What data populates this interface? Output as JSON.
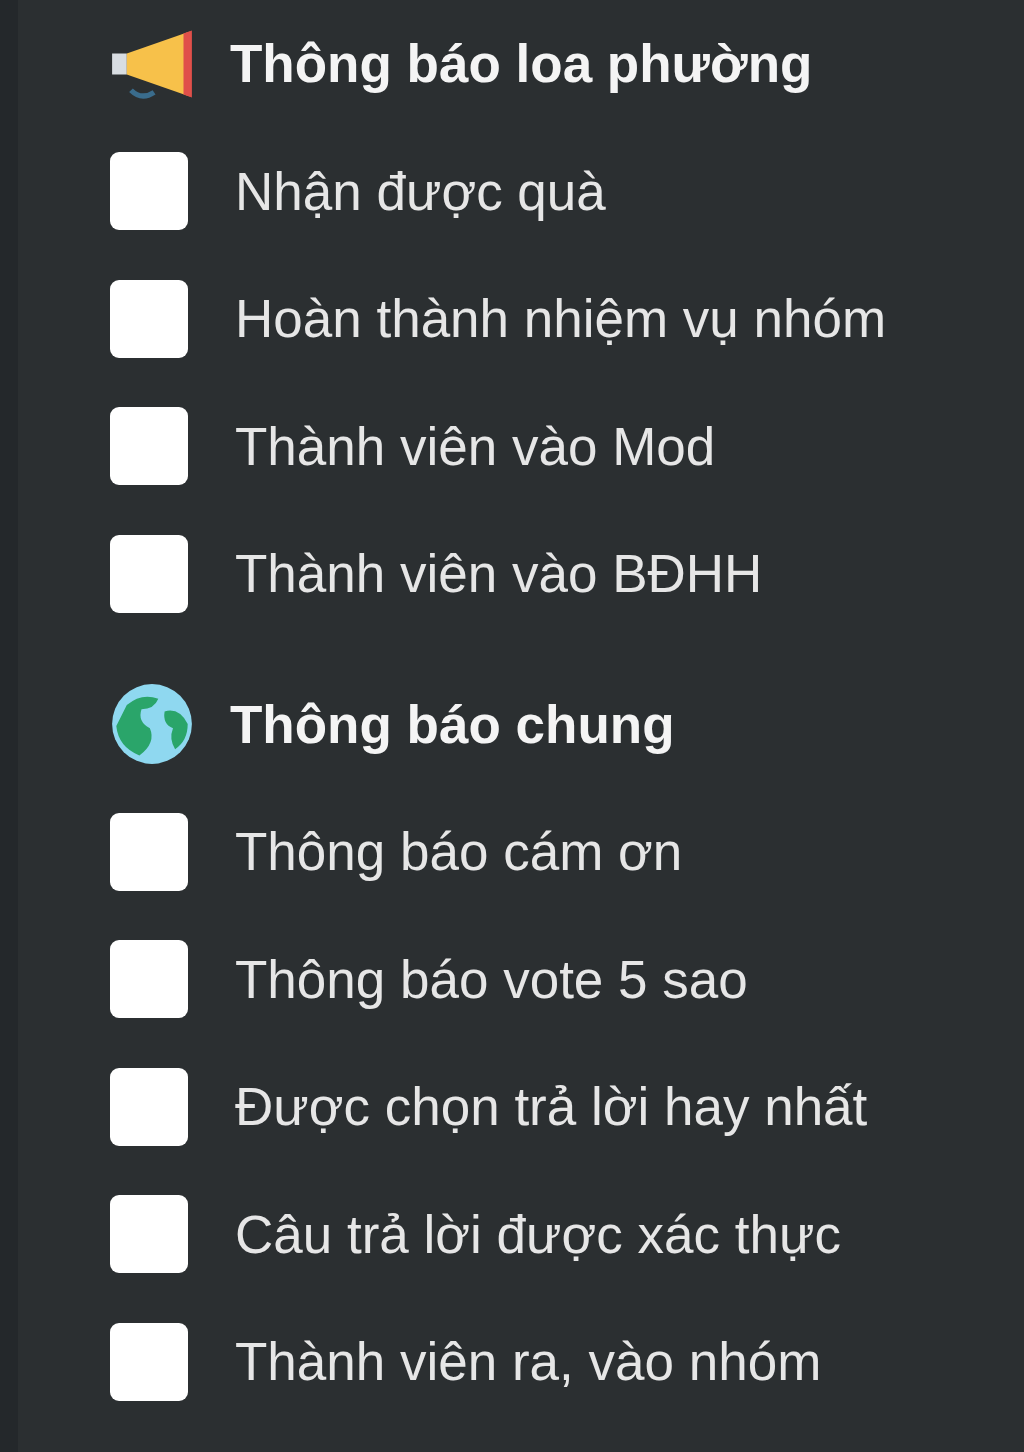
{
  "sections": [
    {
      "title": "Thông báo loa phường",
      "options": [
        {
          "label": "Nhận được quà",
          "checked": false
        },
        {
          "label": "Hoàn thành nhiệm vụ nhóm",
          "checked": false
        },
        {
          "label": "Thành viên vào Mod",
          "checked": false
        },
        {
          "label": "Thành viên vào BĐHH",
          "checked": false
        }
      ]
    },
    {
      "title": "Thông báo chung",
      "options": [
        {
          "label": "Thông báo cám ơn",
          "checked": false
        },
        {
          "label": "Thông báo vote 5 sao",
          "checked": false
        },
        {
          "label": "Được chọn trả lời hay nhất",
          "checked": false
        },
        {
          "label": "Câu trả lời được xác thực",
          "checked": false
        },
        {
          "label": "Thành viên ra, vào nhóm",
          "checked": false
        }
      ]
    }
  ]
}
